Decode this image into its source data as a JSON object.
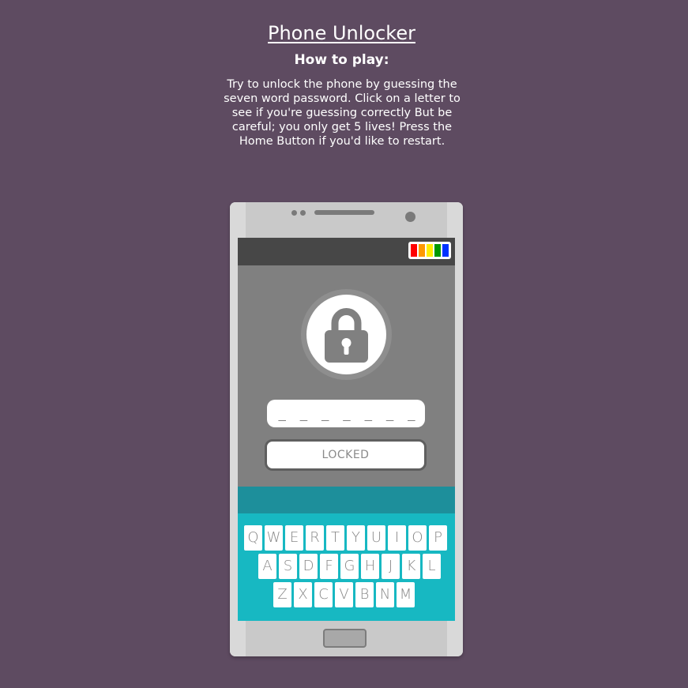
{
  "header": {
    "title": "Phone Unlocker",
    "subtitle": "How to play:",
    "instructions": "Try to unlock the phone by guessing the seven word password. Click on a letter to see if you're guessing correctly But be careful; you only get 5 lives! Press the Home Button if you'd like to restart."
  },
  "phone": {
    "battery_colors": [
      "#ff0000",
      "#ff9900",
      "#ffee00",
      "#009900",
      "#0033ff"
    ],
    "password_display": "_ _ _ _ _ _ _",
    "status_label": "LOCKED"
  },
  "keyboard": {
    "row1": [
      "Q",
      "W",
      "E",
      "R",
      "T",
      "Y",
      "U",
      "I",
      "O",
      "P"
    ],
    "row2": [
      "A",
      "S",
      "D",
      "F",
      "G",
      "H",
      "J",
      "K",
      "L"
    ],
    "row3": [
      "Z",
      "X",
      "C",
      "V",
      "B",
      "N",
      "M"
    ]
  },
  "colors": {
    "background": "#5e4b61",
    "screen": "#808080",
    "keyboard": "#17b8c2",
    "keyboard_top": "#1d8f9b"
  }
}
